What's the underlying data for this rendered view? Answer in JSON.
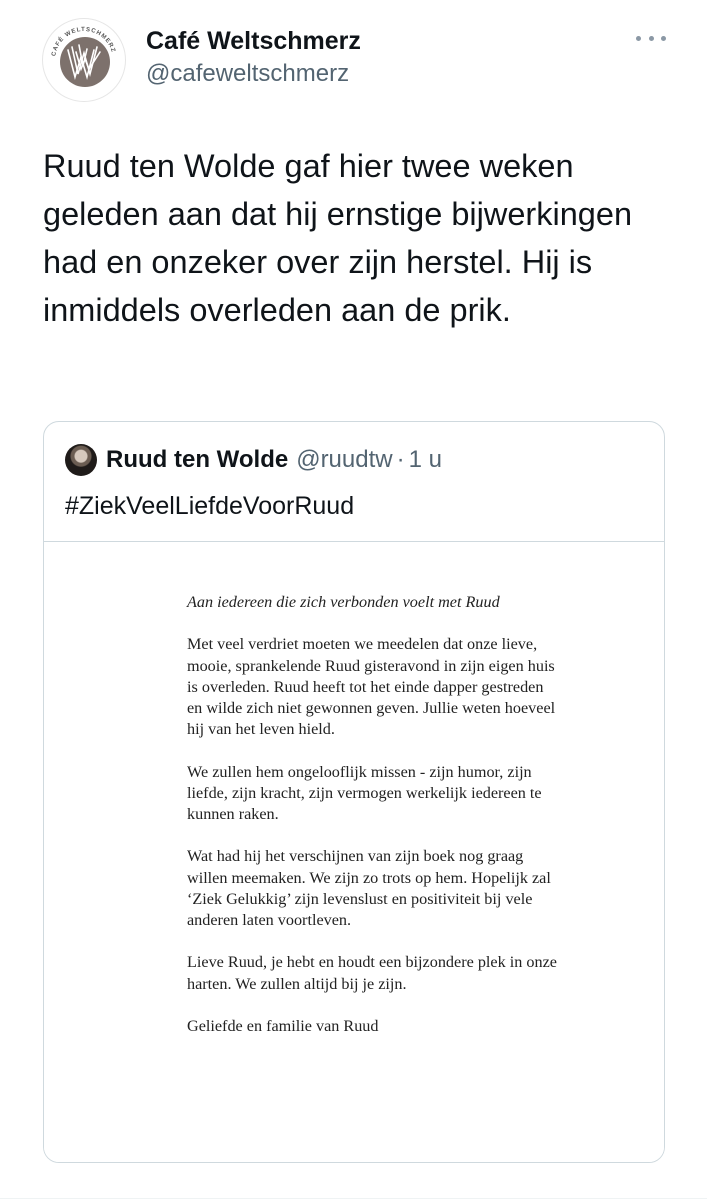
{
  "tweet": {
    "display_name": "Café Weltschmerz",
    "handle": "@cafeweltschmerz",
    "logo_text": "CAFÉ WELTSCHMERZ",
    "text": "Ruud ten Wolde gaf hier twee weken geleden aan dat hij ernstige bijwerkingen had en onzeker over zijn herstel. Hij is inmiddels overleden aan de prik.",
    "more_icon": "more-horizontal-icon"
  },
  "quoted_tweet": {
    "display_name": "Ruud ten Wolde",
    "handle": "@ruudtw",
    "separator": "·",
    "time": "1 u",
    "text": "#ZiekVeelLiefdeVoorRuud",
    "letter": {
      "greeting": "Aan iedereen die zich verbonden voelt met Ruud",
      "paragraph_1": "Met veel verdriet moeten we meedelen dat onze lieve, mooie, sprankelende Ruud gisteravond in zijn eigen huis is overleden. Ruud heeft tot het einde dapper gestreden en wilde zich niet gewonnen geven. Jullie weten hoeveel hij van het leven hield.",
      "paragraph_2": "We zullen hem ongelooflijk missen - zijn humor, zijn liefde, zijn kracht, zijn vermogen werkelijk iedereen te kunnen raken.",
      "paragraph_3": "Wat had hij het verschijnen van zijn boek nog graag willen meemaken. We zijn zo trots op hem. Hopelijk zal ‘Ziek Gelukkig’ zijn levenslust en positiviteit bij vele anderen laten voortleven.",
      "paragraph_4": "Lieve Ruud, je hebt en houdt een bijzondere plek in onze harten. We zullen altijd bij je zijn.",
      "signature": "Geliefde en familie van Ruud"
    }
  },
  "colors": {
    "text_primary": "#0f1419",
    "text_secondary": "#536471",
    "border": "#cfd9de",
    "logo_bg": "#7d716c"
  }
}
